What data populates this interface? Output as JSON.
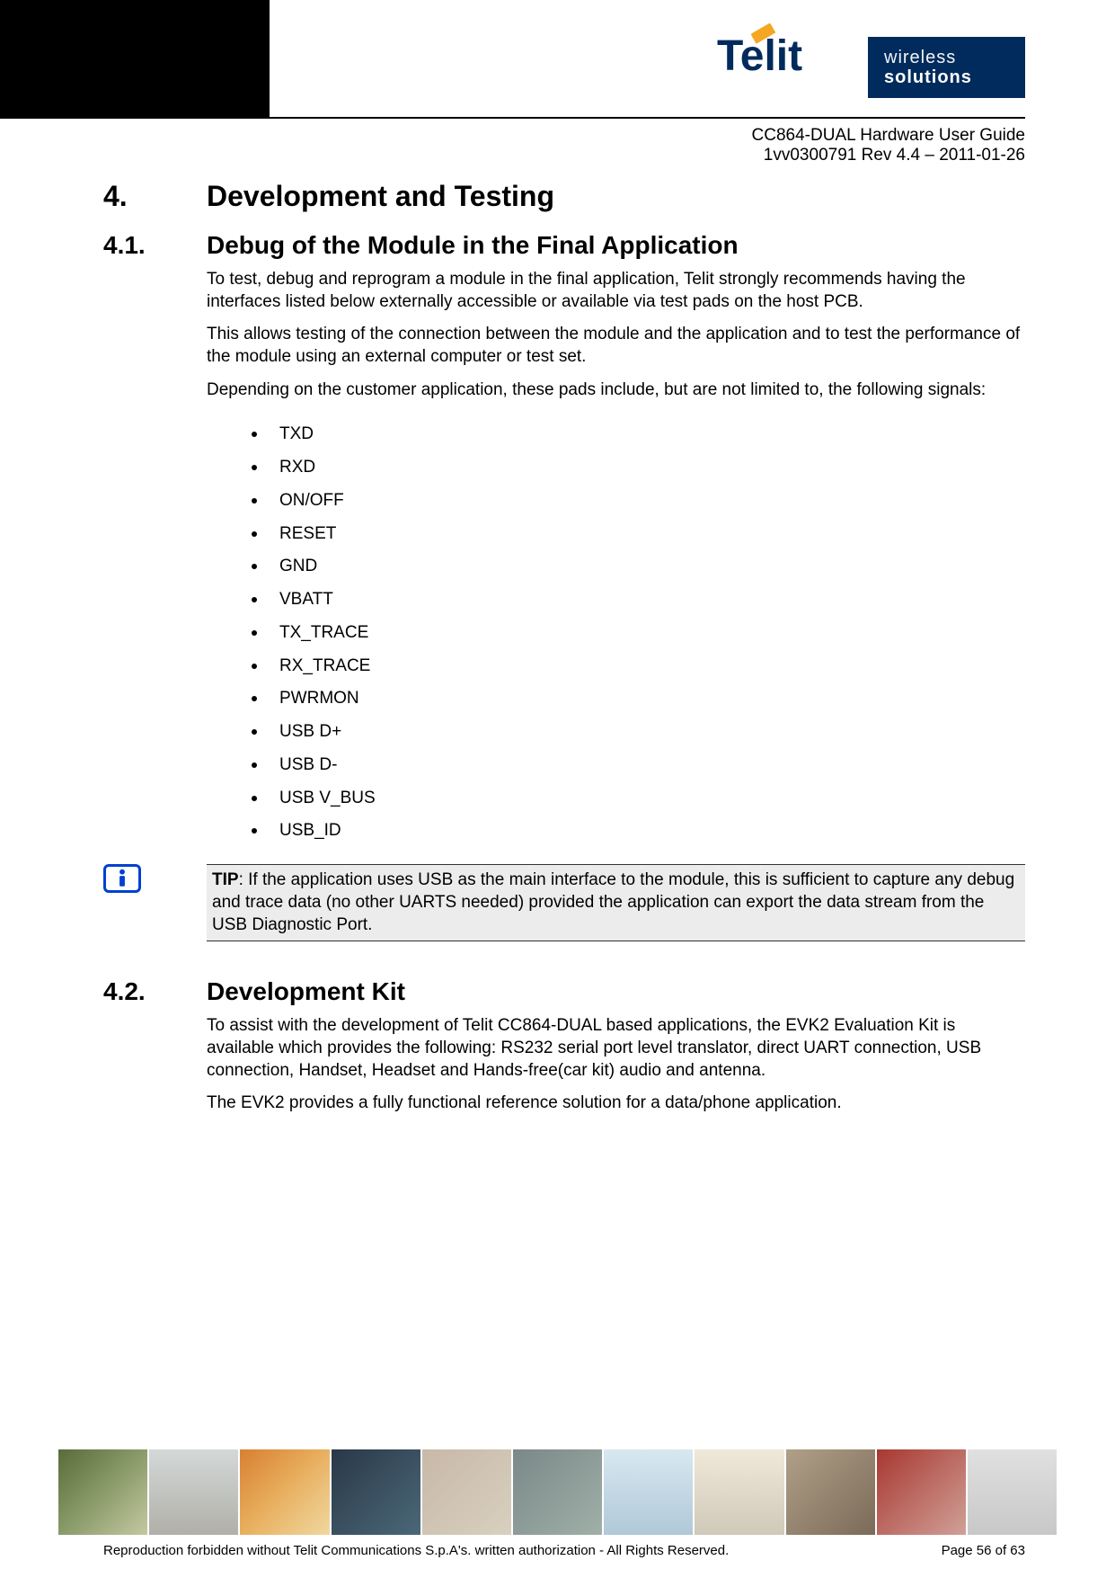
{
  "header": {
    "doc_title": "CC864-DUAL Hardware User Guide",
    "doc_rev": "1vv0300791 Rev 4.4 – 2011-01-26",
    "logo_text": "Telit",
    "tagline_w1": "wireless",
    "tagline_w2": "solutions"
  },
  "sections": {
    "s4_num": "4.",
    "s4_title": "Development and Testing",
    "s41_num": "4.1.",
    "s41_title": "Debug of the Module in the Final Application",
    "s41_p1": "To test, debug and reprogram a module in the final application, Telit strongly recommends having the interfaces listed below externally accessible or available via test pads on the host PCB.",
    "s41_p2": "This allows testing of the connection between the module and the application and to test the performance of the module using an external computer or test set.",
    "s41_p3": "Depending on the customer application, these pads include, but are not limited to, the following signals:",
    "signals": [
      "TXD",
      "RXD",
      "ON/OFF",
      "RESET",
      "GND",
      "VBATT",
      "TX_TRACE",
      "RX_TRACE",
      "PWRMON",
      "USB D+",
      "USB D-",
      "USB V_BUS",
      "USB_ID"
    ],
    "tip_label": "TIP",
    "tip_text": ": If the application uses USB as the main interface to the module, this is sufficient to capture any debug and trace data (no other UARTS needed) provided the application can export the data stream from the USB Diagnostic Port.",
    "s42_num": "4.2.",
    "s42_title": "Development Kit",
    "s42_p1": "To assist with the development of Telit CC864-DUAL based applications, the EVK2 Evaluation Kit is available which provides the following: RS232 serial port level translator, direct UART connection, USB connection, Handset, Headset and Hands-free(car kit) audio and antenna.",
    "s42_p2": "The EVK2 provides a fully functional reference solution for a data/phone application."
  },
  "footer": {
    "copyright": "Reproduction forbidden without Telit Communications S.p.A's. written authorization - All Rights Reserved.",
    "page": "Page 56 of 63"
  }
}
